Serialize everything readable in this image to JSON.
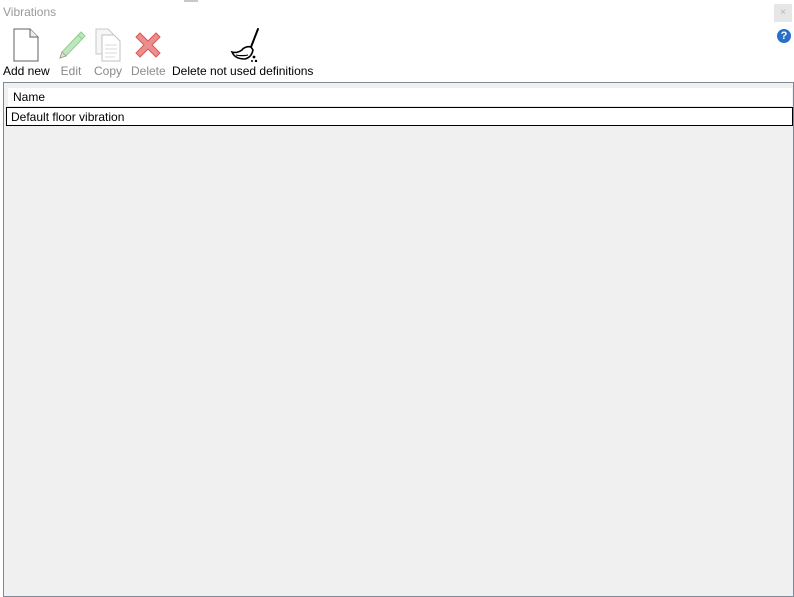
{
  "window": {
    "title": "Vibrations",
    "close_glyph": "×",
    "help_glyph": "?"
  },
  "toolbar": {
    "add_new": "Add new",
    "edit": "Edit",
    "copy": "Copy",
    "delete": "Delete",
    "delete_unused": "Delete not used definitions"
  },
  "icons": {
    "add_new": "blank-page-icon",
    "edit": "pencil-icon",
    "copy": "copy-pages-icon",
    "delete": "red-x-icon",
    "delete_unused": "broom-icon",
    "help": "question-mark-icon"
  },
  "colors": {
    "accent": "#2a6fc9",
    "delete": "#e05555",
    "edit": "#8fd08f"
  },
  "grid": {
    "columns": [
      "Name"
    ],
    "rows": [
      [
        "Default floor vibration"
      ]
    ]
  }
}
